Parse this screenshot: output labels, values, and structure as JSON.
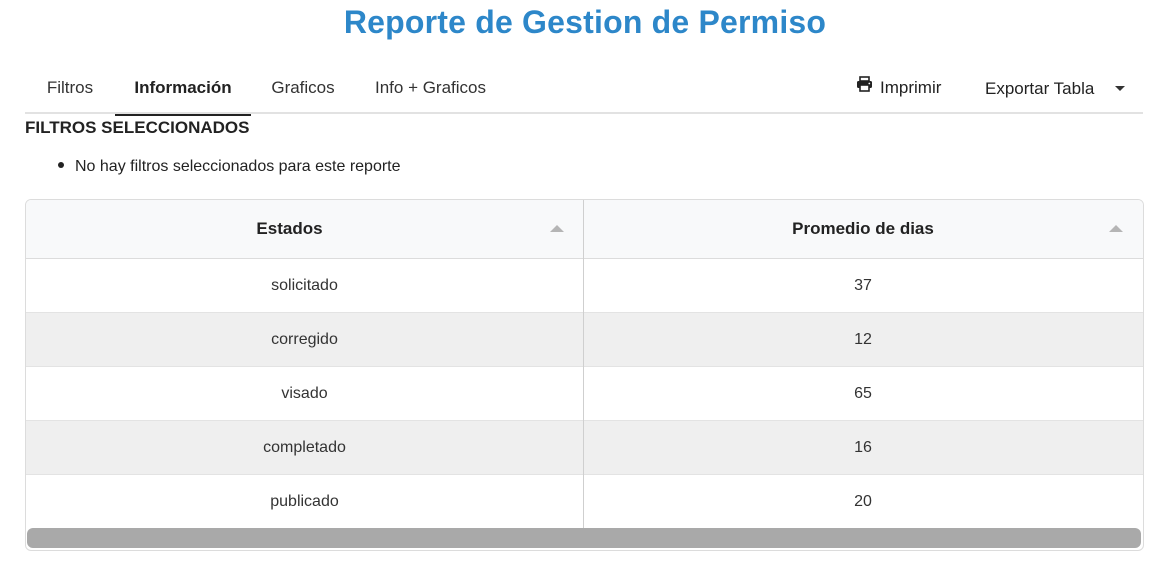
{
  "page": {
    "title": "Reporte de Gestion de Permiso"
  },
  "nav": {
    "tabs": [
      {
        "label": "Filtros",
        "active": false
      },
      {
        "label": "Información",
        "active": true
      },
      {
        "label": "Graficos",
        "active": false
      },
      {
        "label": "Info + Graficos",
        "active": false
      }
    ],
    "print_label": "Imprimir",
    "print_icon": "printer-icon",
    "export_label": "Exportar Tabla",
    "export_icon": "caret-down-icon"
  },
  "filters": {
    "heading": "FILTROS SELECCIONADOS",
    "items": [
      "No hay filtros seleccionados para este reporte"
    ]
  },
  "table": {
    "columns": [
      "Estados",
      "Promedio de dias"
    ],
    "sort_icon": "sort-asc-icon",
    "rows": [
      [
        "solicitado",
        "37"
      ],
      [
        "corregido",
        "12"
      ],
      [
        "visado",
        "65"
      ],
      [
        "completado",
        "16"
      ],
      [
        "publicado",
        "20"
      ]
    ]
  },
  "colors": {
    "title": "#2d87c9",
    "header_bg": "#f8f9fa",
    "alt_row_bg": "#efefef",
    "scrollbar": "#a9a9a9"
  }
}
